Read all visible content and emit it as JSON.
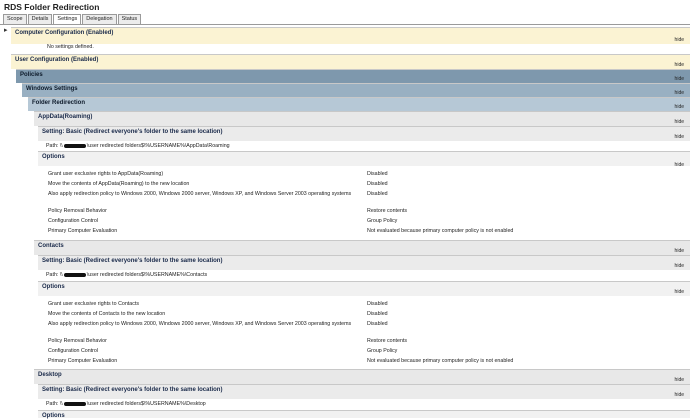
{
  "window": {
    "title": "RDS Folder Redirection",
    "tabs": [
      "Scope",
      "Details",
      "Settings",
      "Delegation",
      "Status"
    ],
    "active_tab": "Settings"
  },
  "hide_label": "hide",
  "computer_config": {
    "label": "Computer Configuration (Enabled)",
    "note": "No settings defined."
  },
  "user_config": {
    "label": "User Configuration (Enabled)"
  },
  "policies": {
    "label": "Policies"
  },
  "windows_settings": {
    "label": "Windows Settings"
  },
  "folder_redirection": {
    "label": "Folder Redirection"
  },
  "appdata": {
    "label": "AppData(Roaming)",
    "setting_label": "Setting: Basic (Redirect everyone's folder to the same location)",
    "path_prefix": "Path: \\\\",
    "path_suffix": "\\user redirected folders$\\%USERNAME%\\AppData\\Roaming",
    "options_label": "Options",
    "options": [
      {
        "k": "Grant user exclusive rights to AppData(Roaming)",
        "v": "Disabled"
      },
      {
        "k": "Move the contents of AppData(Roaming) to the new location",
        "v": "Disabled"
      },
      {
        "k": "Also apply redirection policy to Windows 2000, Windows 2000 server, Windows XP, and Windows Server 2003 operating systems",
        "v": "Disabled"
      }
    ],
    "policy": [
      {
        "k": "Policy Removal Behavior",
        "v": "Restore contents"
      },
      {
        "k": "Configuration Control",
        "v": "Group Policy"
      },
      {
        "k": "Primary Computer Evaluation",
        "v": "Not evaluated because primary computer policy is not enabled"
      }
    ]
  },
  "contacts": {
    "label": "Contacts",
    "setting_label": "Setting: Basic (Redirect everyone's folder to the same location)",
    "path_prefix": "Path: \\\\",
    "path_suffix": "\\user redirected folders$\\%USERNAME%\\Contacts",
    "options_label": "Options",
    "options": [
      {
        "k": "Grant user exclusive rights to Contacts",
        "v": "Disabled"
      },
      {
        "k": "Move the contents of Contacts to the new location",
        "v": "Disabled"
      },
      {
        "k": "Also apply redirection policy to Windows 2000, Windows 2000 server, Windows XP, and Windows Server 2003 operating systems",
        "v": "Disabled"
      }
    ],
    "policy": [
      {
        "k": "Policy Removal Behavior",
        "v": "Restore contents"
      },
      {
        "k": "Configuration Control",
        "v": "Group Policy"
      },
      {
        "k": "Primary Computer Evaluation",
        "v": "Not evaluated because primary computer policy is not enabled"
      }
    ]
  },
  "desktop": {
    "label": "Desktop",
    "setting_label": "Setting: Basic (Redirect everyone's folder to the same location)",
    "path_prefix": "Path: \\\\",
    "path_suffix": "\\user redirected folders$\\%USERNAME%\\Desktop",
    "options_label": "Options"
  }
}
